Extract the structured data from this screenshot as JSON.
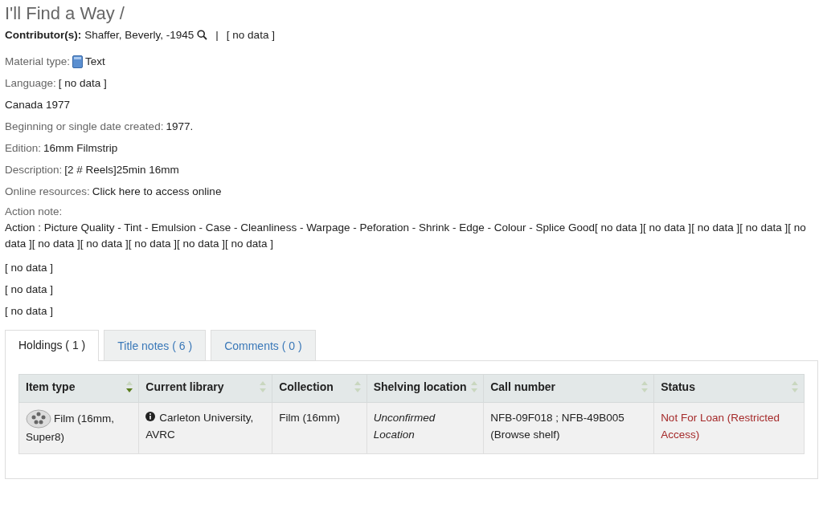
{
  "title": "I'll Find a Way /",
  "contributors": {
    "label": "Contributor(s):",
    "name": "Shaffer, Beverly, -1945",
    "separator": "|",
    "other": "[ no data ]"
  },
  "fields": [
    {
      "kind": "material",
      "label": "Material type:",
      "value": "Text"
    },
    {
      "kind": "plain",
      "label": "Language:",
      "value": "[ no data ]"
    },
    {
      "kind": "plain",
      "value": "Canada 1977"
    },
    {
      "kind": "plain",
      "label": "Beginning or single date created:",
      "value": "1977."
    },
    {
      "kind": "plain",
      "label": "Edition:",
      "value": "16mm Filmstrip"
    },
    {
      "kind": "plain",
      "label": "Description:",
      "value": "[2 # Reels]25min 16mm"
    },
    {
      "kind": "link",
      "label": "Online resources:",
      "value": "Click here to access online"
    },
    {
      "kind": "block",
      "label": "Action note:",
      "value": "Action : Picture Quality - Tint - Emulsion - Case - Cleanliness - Warpage - Peforation - Shrink - Edge - Colour - Splice Good[ no data ][ no data ][ no data ][ no data ][ no data ][ no data ][ no data ][ no data ][ no data ][ no data ]"
    },
    {
      "kind": "plain",
      "value": "[ no data ]"
    },
    {
      "kind": "plain",
      "value": "[ no data ]"
    },
    {
      "kind": "plain",
      "value": "[ no data ]"
    }
  ],
  "tabs": [
    {
      "label": "Holdings ( 1 )",
      "selected": true
    },
    {
      "label": "Title notes ( 6 )",
      "selected": false
    },
    {
      "label": "Comments ( 0 )",
      "selected": false
    }
  ],
  "table": {
    "columns": [
      {
        "label": "Item type",
        "sorted": true
      },
      {
        "label": "Current library",
        "sorted": false
      },
      {
        "label": "Collection",
        "sorted": false
      },
      {
        "label": "Shelving location",
        "sorted": false
      },
      {
        "label": "Call number",
        "sorted": false
      },
      {
        "label": "Status",
        "sorted": false
      }
    ],
    "rows": [
      [
        {
          "kind": "itemtype",
          "text": "Film (16mm, Super8)"
        },
        {
          "kind": "library",
          "text": "Carleton University, AVRC"
        },
        {
          "kind": "plain",
          "text": "Film (16mm)"
        },
        {
          "kind": "italic",
          "text": "Unconfirmed Location"
        },
        {
          "kind": "plain",
          "text": "NFB-09F018 ; NFB-49B005 (Browse shelf)"
        },
        {
          "kind": "status",
          "text": "Not For Loan (Restricted Access)"
        }
      ]
    ]
  }
}
